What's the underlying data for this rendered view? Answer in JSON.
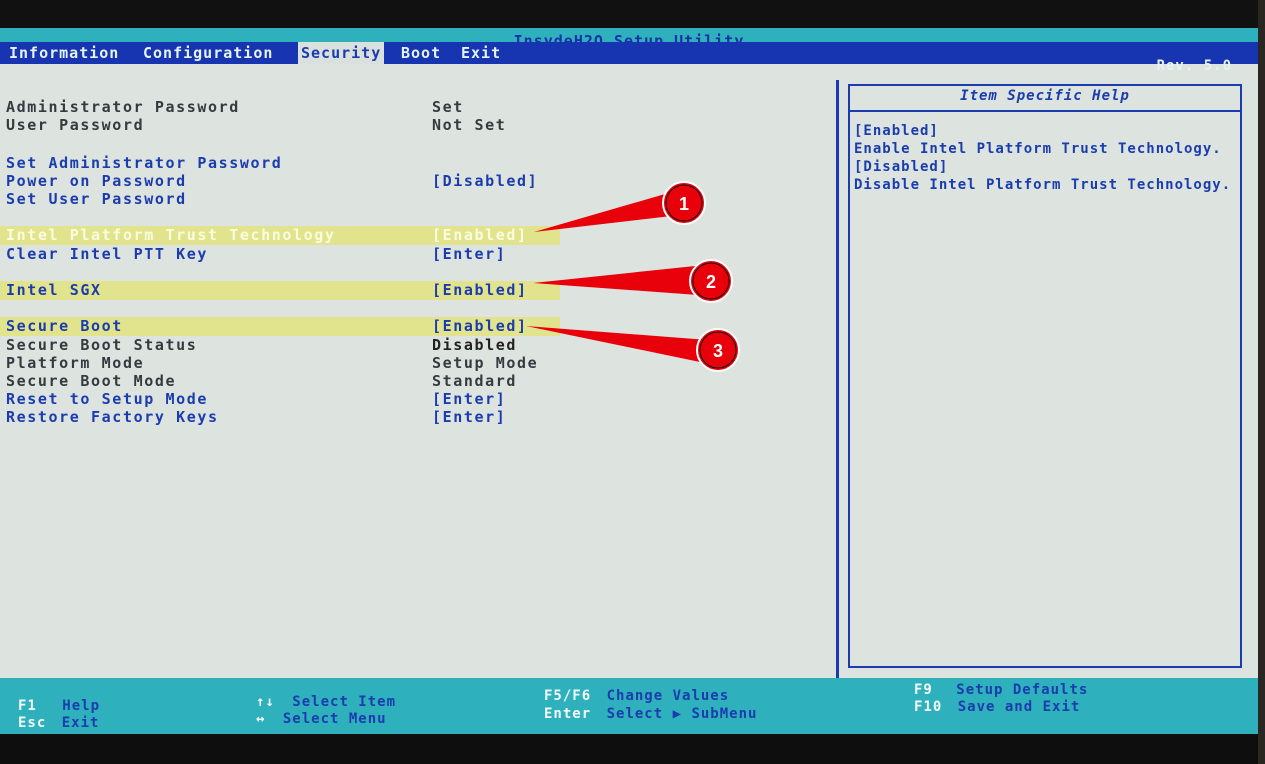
{
  "title": "InsydeH2O Setup Utility",
  "revision": "Rev. 5.0",
  "menu": [
    "Information",
    "Configuration",
    "Security",
    "Boot",
    "Exit"
  ],
  "active_menu": "Security",
  "settings": [
    {
      "label": "Administrator Password",
      "value": "Set",
      "type": "static"
    },
    {
      "label": "User Password",
      "value": "Not Set",
      "type": "static"
    },
    {
      "label": "Set Administrator Password",
      "value": "",
      "type": "link"
    },
    {
      "label": "Power on Password",
      "value": "[Disabled]",
      "type": "link"
    },
    {
      "label": "Set User Password",
      "value": "",
      "type": "link"
    },
    {
      "label": "Intel Platform Trust Technology",
      "value": "[Enabled]",
      "type": "link"
    },
    {
      "label": "Clear Intel PTT Key",
      "value": "[Enter]",
      "type": "link"
    },
    {
      "label": "Intel SGX",
      "value": "[Enabled]",
      "type": "link"
    },
    {
      "label": "Secure Boot",
      "value": "[Enabled]",
      "type": "link"
    },
    {
      "label": "Secure Boot Status",
      "value": "Disabled",
      "type": "static"
    },
    {
      "label": "Platform Mode",
      "value": "Setup Mode",
      "type": "static"
    },
    {
      "label": "Secure Boot Mode",
      "value": "Standard",
      "type": "static"
    },
    {
      "label": "Reset to Setup Mode",
      "value": "[Enter]",
      "type": "link"
    },
    {
      "label": "Restore Factory Keys",
      "value": "[Enter]",
      "type": "link"
    }
  ],
  "help": {
    "title": "Item Specific Help",
    "lines": [
      "[Enabled]",
      "Enable Intel Platform Trust Technology.",
      "[Disabled]",
      "Disable Intel Platform Trust Technology."
    ]
  },
  "footer": {
    "f1_key": "F1",
    "f1_desc": "Help",
    "esc_key": "Esc",
    "esc_desc": "Exit",
    "updown_key": "↑↓",
    "updown_desc": "Select Item",
    "leftright_key": "↔",
    "leftright_desc": "Select Menu",
    "f5f6_key": "F5/F6",
    "f5f6_desc": "Change Values",
    "enter_key": "Enter",
    "enter_desc": "Select ▶ SubMenu",
    "f9_key": "F9",
    "f9_desc": "Setup Defaults",
    "f10_key": "F10",
    "f10_desc": "Save and Exit"
  },
  "callouts": [
    "1",
    "2",
    "3"
  ],
  "colors": {
    "bios_blue": "#1b3cae",
    "bios_cyan": "#2fb0bd",
    "highlight": "#e2e48d",
    "callout_red": "#e8000b"
  }
}
